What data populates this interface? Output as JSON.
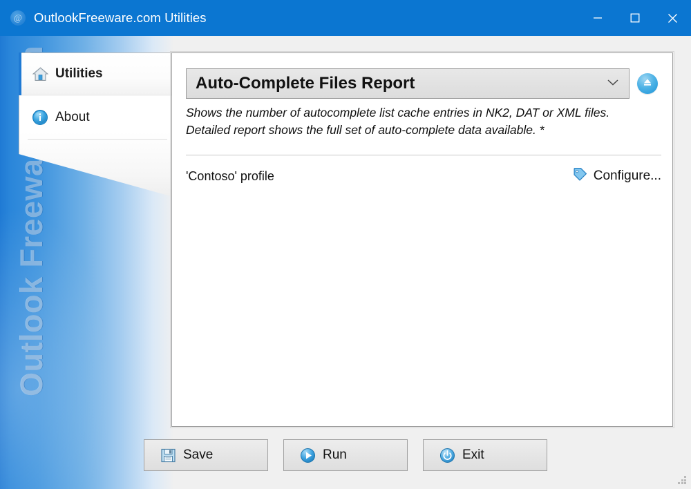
{
  "window": {
    "title": "OutlookFreeware.com Utilities",
    "app_icon": "at-circle-icon",
    "controls": {
      "minimize": "minimize-icon",
      "maximize": "maximize-icon",
      "close": "close-icon"
    },
    "titlebar_color": "#0b76d1"
  },
  "sidebar": {
    "watermark": "Outlook Freeware .com",
    "gradient_from": "#1f7ad4",
    "gradient_to": "#f0f0f0",
    "items": [
      {
        "label": "Utilities",
        "icon": "home-icon",
        "selected": true
      },
      {
        "label": "About",
        "icon": "info-icon",
        "selected": false
      }
    ]
  },
  "main": {
    "report_select": {
      "value": "Auto-Complete Files Report",
      "chevron": "chevron-down-icon"
    },
    "eject_button": {
      "icon": "eject-icon",
      "color": "#1b93d8"
    },
    "description": "Shows the number of autocomplete list cache entries in NK2, DAT or XML files. Detailed report shows the full set of auto-complete data available. *",
    "profile": {
      "name": "'Contoso' profile",
      "configure_label": "Configure...",
      "configure_icon": "tag-icon"
    }
  },
  "footer": {
    "buttons": [
      {
        "label": "Save",
        "icon": "floppy-disk-icon"
      },
      {
        "label": "Run",
        "icon": "play-circle-icon"
      },
      {
        "label": "Exit",
        "icon": "power-circle-icon"
      }
    ]
  }
}
